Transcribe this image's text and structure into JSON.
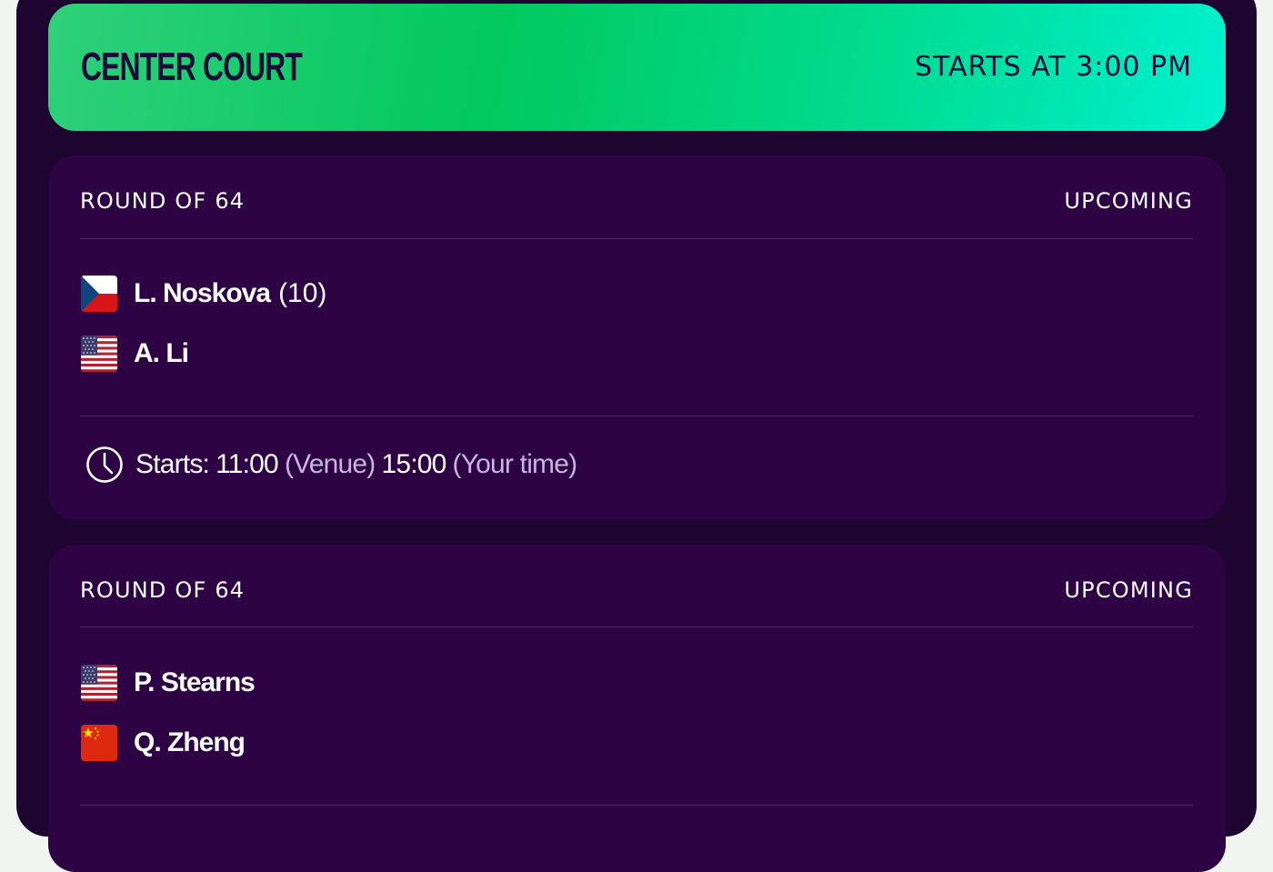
{
  "court": {
    "title": "CENTER COURT",
    "starts": "STARTS AT 3:00 PM"
  },
  "matches": [
    {
      "round": "ROUND OF 64",
      "status": "UPCOMING",
      "players": [
        {
          "name": "L. Noskova",
          "seed": "(10)",
          "flag_icon": "czech-flag-icon"
        },
        {
          "name": "A. Li",
          "seed": "",
          "flag_icon": "usa-flag-icon"
        }
      ],
      "start": {
        "prefix": "Starts:",
        "venue_time": "11:00",
        "venue_label": "(Venue)",
        "local_time": "15:00",
        "local_label": "(Your time)"
      }
    },
    {
      "round": "ROUND OF 64",
      "status": "UPCOMING",
      "players": [
        {
          "name": "P. Stearns",
          "seed": "",
          "flag_icon": "usa-flag-icon"
        },
        {
          "name": "Q. Zheng",
          "seed": "",
          "flag_icon": "china-flag-icon"
        }
      ]
    }
  ],
  "colors": {
    "page_background": "#1e0530",
    "card_background": "#2d0344",
    "header_gradient_start": "#02c85e",
    "header_gradient_end": "#00f0cf",
    "header_text": "#1b0a3a",
    "muted_text": "#c7b5dd"
  }
}
